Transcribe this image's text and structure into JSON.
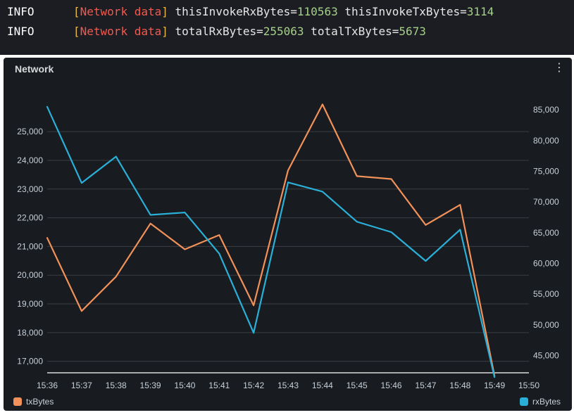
{
  "terminal": {
    "lines": [
      {
        "level": "INFO",
        "tag_open": "[",
        "tag": "Network data",
        "tag_close": "]",
        "k1": "thisInvokeRxBytes=",
        "v1": "110563",
        "k2": " thisInvokeTxBytes=",
        "v2": "3114"
      },
      {
        "level": "INFO",
        "tag_open": "[",
        "tag": "Network data",
        "tag_close": "]",
        "k1": "totalRxBytes=",
        "v1": "255063",
        "k2": " totalTxBytes=",
        "v2": "5673"
      }
    ]
  },
  "panel": {
    "title": "Network",
    "menu_icon": "⋮"
  },
  "colors": {
    "tx": "#f2915a",
    "rx": "#2ab0d8",
    "grid": "#3a3f45",
    "panel_bg": "#181b1f"
  },
  "chart_data": {
    "type": "line",
    "title": "Network",
    "x": [
      "15:36",
      "15:37",
      "15:38",
      "15:39",
      "15:40",
      "15:41",
      "15:42",
      "15:43",
      "15:44",
      "15:45",
      "15:46",
      "15:47",
      "15:48",
      "15:49"
    ],
    "x_ticks": [
      "15:36",
      "15:37",
      "15:38",
      "15:39",
      "15:40",
      "15:41",
      "15:42",
      "15:43",
      "15:44",
      "15:45",
      "15:46",
      "15:47",
      "15:48",
      "15:49",
      "15:50"
    ],
    "series": [
      {
        "name": "txBytes",
        "axis": "left",
        "color": "#f2915a",
        "values": [
          21300,
          18750,
          19950,
          21800,
          20900,
          21400,
          18950,
          23650,
          25950,
          23450,
          23350,
          21750,
          22450,
          16500
        ]
      },
      {
        "name": "rxBytes",
        "axis": "right",
        "color": "#2ab0d8",
        "values": [
          85500,
          73100,
          77400,
          67900,
          68300,
          61600,
          48700,
          73200,
          71700,
          66800,
          65100,
          60400,
          65500,
          41500
        ]
      }
    ],
    "y_left": {
      "ticks": [
        "25,000",
        "24,000",
        "23,000",
        "22,000",
        "21,000",
        "20,000",
        "19,000",
        "18,000",
        "17,000"
      ],
      "tick_values": [
        25000,
        24000,
        23000,
        22000,
        21000,
        20000,
        19000,
        18000,
        17000
      ],
      "range": [
        16600,
        26400
      ]
    },
    "y_right": {
      "ticks": [
        "85,000",
        "80,000",
        "75,000",
        "70,000",
        "65,000",
        "60,000",
        "55,000",
        "50,000",
        "45,000"
      ],
      "tick_values": [
        85000,
        80000,
        75000,
        70000,
        65000,
        60000,
        55000,
        50000,
        45000
      ],
      "range": [
        42200,
        88000
      ]
    },
    "grid": true,
    "legend": [
      {
        "name": "txBytes",
        "placement": "bottom-left"
      },
      {
        "name": "rxBytes",
        "placement": "bottom-right"
      }
    ]
  }
}
